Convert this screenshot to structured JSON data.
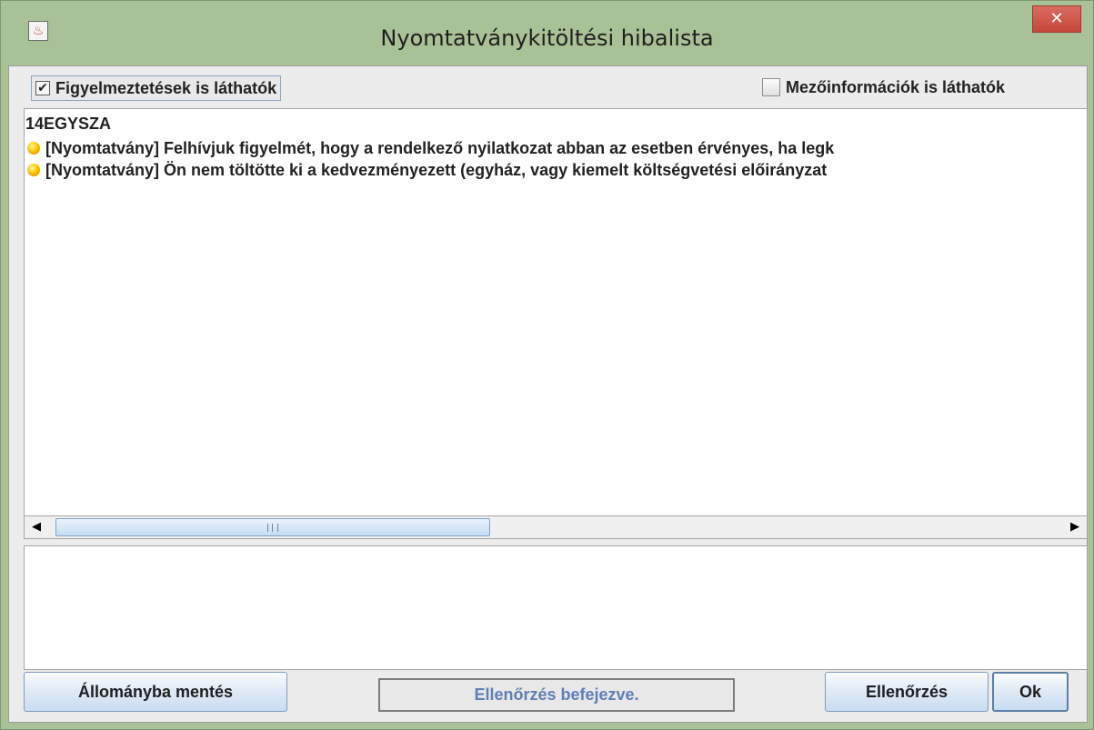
{
  "window": {
    "title": "Nyomtatványkitöltési hibalista",
    "close_glyph": "✕",
    "app_icon": "java-icon"
  },
  "options": {
    "warnings_label": "Figyelmeztetések is láthatók",
    "warnings_checked": true,
    "warnings_check_glyph": "✔",
    "fieldinfo_label": "Mezőinformációk is láthatók",
    "fieldinfo_checked": false
  },
  "list": {
    "group_title": "14EGYSZA",
    "items": [
      {
        "icon": "warning-dot-icon",
        "text": "[Nyomtatvány] Felhívjuk figyelmét, hogy a rendelkező  nyilatkozat abban az esetben érvényes, ha legk"
      },
      {
        "icon": "warning-dot-icon",
        "text": "[Nyomtatvány] Ön nem töltötte ki a kedvezményezett (egyház,  vagy kiemelt költségvetési előirányzat"
      }
    ]
  },
  "scrollbar": {
    "left_arrow": "◀",
    "right_arrow": "▶"
  },
  "footer": {
    "save_label": "Állományba mentés",
    "status_text": "Ellenőrzés befejezve.",
    "check_label": "Ellenőrzés",
    "ok_label": "Ok"
  },
  "colors": {
    "frame": "#a9c196",
    "close_button": "#c7463a",
    "status_text": "#5e7fb6",
    "button_gradient_end": "#c9dcf0"
  }
}
